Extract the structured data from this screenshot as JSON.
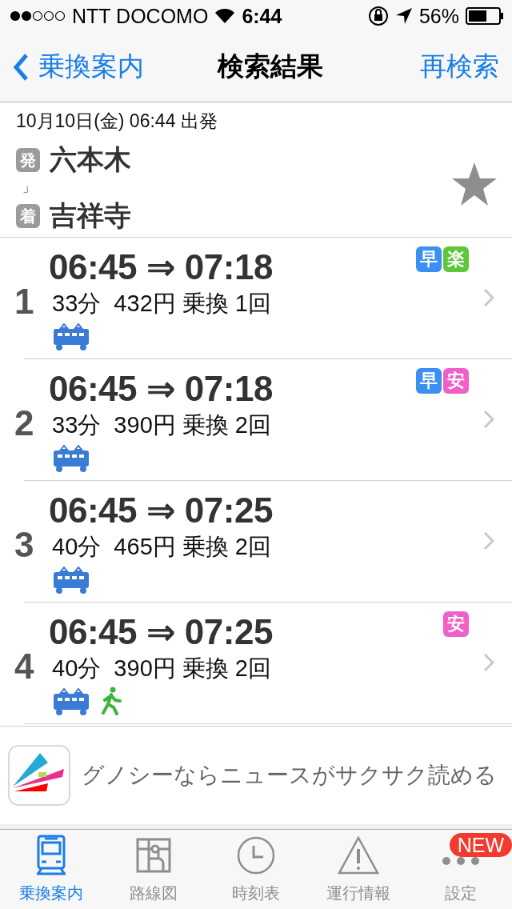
{
  "status_bar": {
    "carrier": "NTT DOCOMO",
    "time": "6:44",
    "battery": "56%"
  },
  "nav": {
    "back": "乗換案内",
    "title": "検索結果",
    "action": "再検索"
  },
  "search": {
    "datetime": "10月10日(金) 06:44 出発",
    "from_tag": "発",
    "from": "六本木",
    "connector": "」",
    "to_tag": "着",
    "to": "吉祥寺",
    "favorite": false
  },
  "routes": [
    {
      "index": "1",
      "times": "06:45 ⇒ 07:18",
      "summary": "33分  432円 乗換 1回",
      "badges": [
        {
          "label": "早",
          "color": "#3b8ff0"
        },
        {
          "label": "楽",
          "color": "#5cc83a"
        }
      ],
      "modes": [
        {
          "kind": "train"
        }
      ]
    },
    {
      "index": "2",
      "times": "06:45 ⇒ 07:18",
      "summary": "33分  390円 乗換 2回",
      "badges": [
        {
          "label": "早",
          "color": "#3b8ff0"
        },
        {
          "label": "安",
          "color": "#f060c8"
        }
      ],
      "modes": [
        {
          "kind": "train"
        }
      ]
    },
    {
      "index": "3",
      "times": "06:45 ⇒ 07:25",
      "summary": "40分  465円 乗換 2回",
      "modes": [
        {
          "kind": "train"
        }
      ]
    },
    {
      "index": "4",
      "times": "06:45 ⇒ 07:25",
      "summary": "40分  390円 乗換 2回",
      "badges": [
        {
          "label": "安",
          "color": "#f060c8"
        }
      ],
      "modes": [
        {
          "kind": "train"
        },
        {
          "kind": "walk"
        }
      ]
    }
  ],
  "ad": {
    "text": "グノシーならニュースがサクサク読める"
  },
  "tabs": [
    {
      "label": "乗換案内",
      "selected": true
    },
    {
      "label": "路線図",
      "selected": false
    },
    {
      "label": "時刻表",
      "selected": false
    },
    {
      "label": "運行情報",
      "selected": false
    },
    {
      "label": "設定",
      "selected": false,
      "badge": "NEW"
    }
  ]
}
